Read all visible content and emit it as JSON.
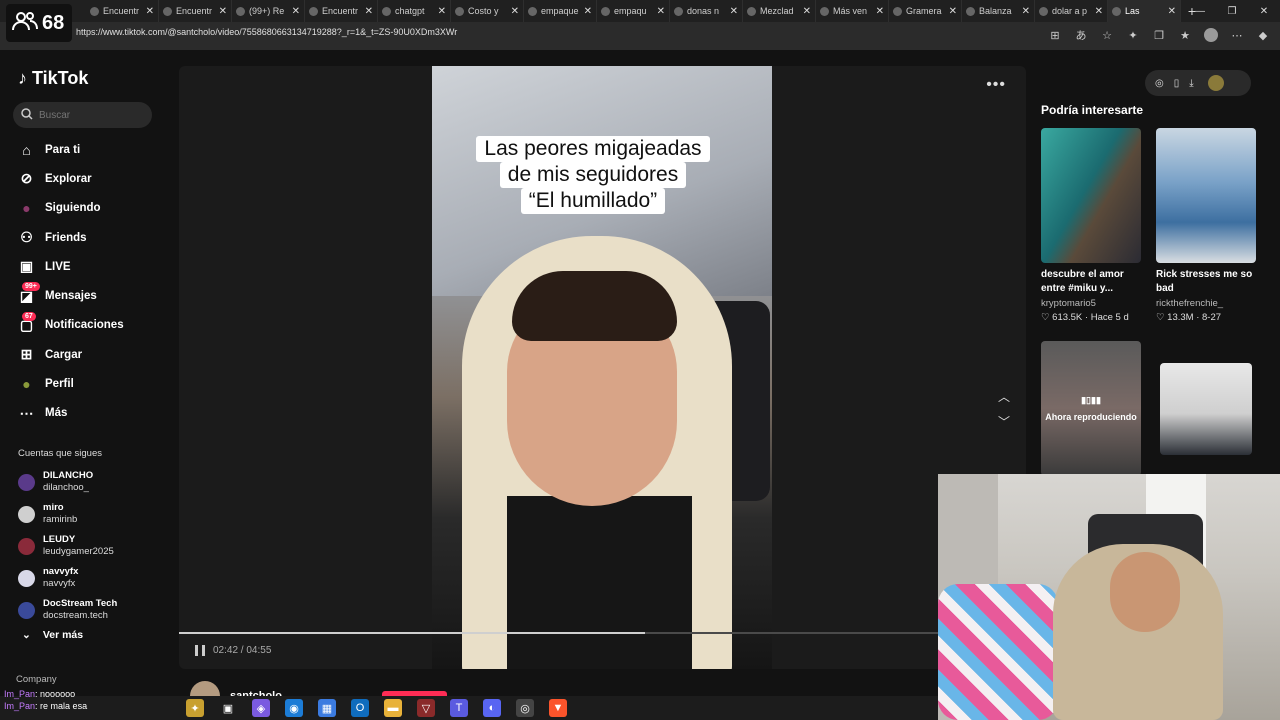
{
  "overlay": {
    "viewer_count": "68"
  },
  "browser": {
    "tabs": [
      {
        "title": "Encuentr",
        "active": false
      },
      {
        "title": "Encuentr",
        "active": false
      },
      {
        "title": "(99+) Re",
        "active": false
      },
      {
        "title": "Encuentr",
        "active": false
      },
      {
        "title": "chatgpt",
        "active": false
      },
      {
        "title": "Costo y",
        "active": false
      },
      {
        "title": "empaque",
        "active": false
      },
      {
        "title": "empaqu",
        "active": false
      },
      {
        "title": "donas n",
        "active": false
      },
      {
        "title": "Mezclad",
        "active": false
      },
      {
        "title": "Más ven",
        "active": false
      },
      {
        "title": "Gramera",
        "active": false
      },
      {
        "title": "Balanza",
        "active": false
      },
      {
        "title": "dolar a p",
        "active": false
      },
      {
        "title": "Las",
        "active": true
      }
    ],
    "url": "https://www.tiktok.com/@santcholo/video/7558680663134719288?_r=1&_t=ZS-90U0XDm3XWr"
  },
  "tiktok": {
    "logo": "TikTok",
    "search_placeholder": "Buscar",
    "nav": [
      {
        "label": "Para ti",
        "icon": "home-icon"
      },
      {
        "label": "Explorar",
        "icon": "compass-icon"
      },
      {
        "label": "Siguiendo",
        "icon": "avatar-icon"
      },
      {
        "label": "Friends",
        "icon": "friends-icon"
      },
      {
        "label": "LIVE",
        "icon": "live-icon"
      },
      {
        "label": "Mensajes",
        "icon": "messages-icon",
        "badge": "99+"
      },
      {
        "label": "Notificaciones",
        "icon": "notifications-icon",
        "badge": "67"
      },
      {
        "label": "Cargar",
        "icon": "upload-icon"
      },
      {
        "label": "Perfil",
        "icon": "profile-icon"
      },
      {
        "label": "Más",
        "icon": "more-icon"
      }
    ],
    "following_title": "Cuentas que sigues",
    "following": [
      {
        "name": "DILANCHO",
        "handle": "dilanchoo_"
      },
      {
        "name": "miro",
        "handle": "ramirinb"
      },
      {
        "name": "LEUDY",
        "handle": "leudygamer2025"
      },
      {
        "name": "navvyfx",
        "handle": "navvyfx"
      },
      {
        "name": "DocStream Tech",
        "handle": "docstream.tech"
      }
    ],
    "see_more": "Ver más",
    "company": "Company",
    "video": {
      "caption_lines": [
        "Las peores migajeadas",
        "de mis seguidores",
        "“El humillado”"
      ],
      "time": "02:42 / 04:55",
      "progress": 0.55,
      "author": "santcholo"
    },
    "recommend_title": "Podría interesarte",
    "recommendations": [
      {
        "title": "descubre el amor entre #miku y...",
        "author": "kryptomario5",
        "stats": "♡ 613.5K · Hace 5 d"
      },
      {
        "title": "Rick stresses me so bad",
        "author": "rickthefrenchie_",
        "stats": "♡ 13.3M · 8-27"
      }
    ],
    "now_playing": "Ahora reproduciendo"
  },
  "chat": [
    {
      "user": "Im_Pan",
      "message": "noooooo"
    },
    {
      "user": "Im_Pan",
      "message": "re mala esa"
    }
  ]
}
